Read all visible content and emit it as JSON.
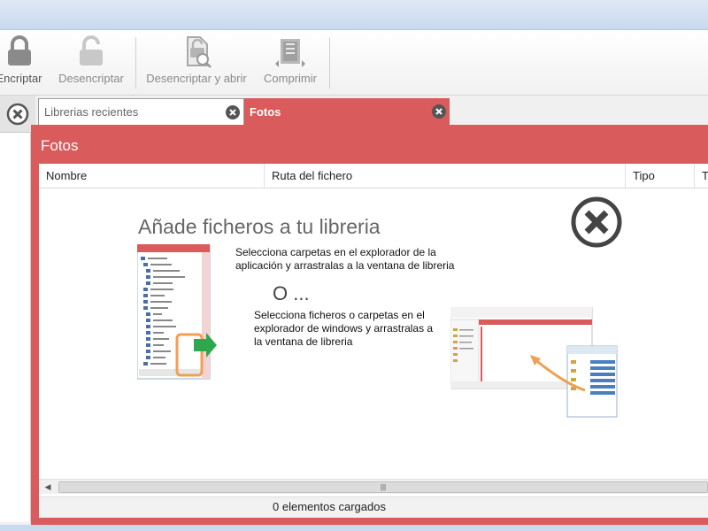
{
  "toolbar": {
    "encrypt_label": "Encriptar",
    "decrypt_label": "Desencriptar",
    "decrypt_open_label": "Desencriptar y abrir",
    "compress_label": "Comprimir"
  },
  "tabs": [
    {
      "label": "Librerias recientes"
    },
    {
      "label": "Fotos"
    }
  ],
  "panel": {
    "title": "Fotos",
    "columns": [
      "Nombre",
      "Ruta del fichero",
      "Tipo",
      "T"
    ]
  },
  "empty_state": {
    "title": "Añade ficheros a tu libreria",
    "instruction_1": "Selecciona carpetas en el explorador de la aplicación y arrastralas a la ventana de libreria",
    "or": "O ...",
    "instruction_2": "Selecciona ficheros o carpetas en el explorador de windows y arrastralas a la ventana de libreria"
  },
  "status": {
    "text": "0 elementos cargados"
  },
  "icons": {
    "encrypt": "lock-icon",
    "decrypt": "unlock-icon",
    "decrypt_open": "decrypt-open-icon",
    "compress": "compress-icon",
    "close": "close-icon"
  },
  "colors": {
    "accent": "#d95b5b",
    "arrow": "#f0a050",
    "green": "#2ea84f"
  }
}
